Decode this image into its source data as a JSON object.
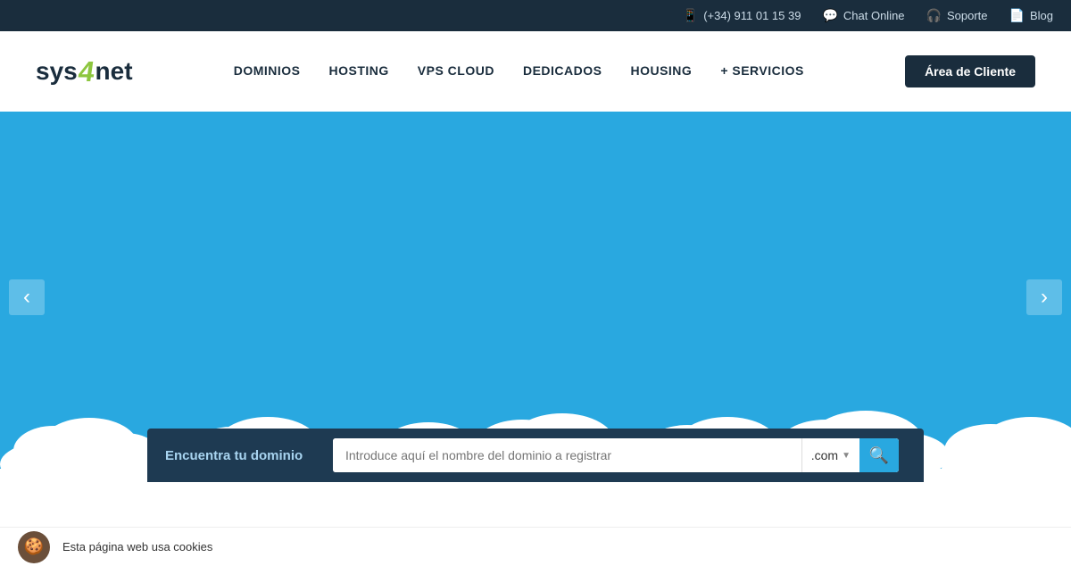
{
  "topbar": {
    "phone": "(+34) 911 01 15 39",
    "chat_label": "Chat Online",
    "soporte_label": "Soporte",
    "blog_label": "Blog"
  },
  "nav": {
    "logo_sys": "sys",
    "logo_4": "4",
    "logo_net": "net",
    "links": [
      {
        "label": "DOMINIOS",
        "id": "nav-dominios"
      },
      {
        "label": "HOSTING",
        "id": "nav-hosting"
      },
      {
        "label": "VPS CLOUD",
        "id": "nav-vps"
      },
      {
        "label": "DEDICADOS",
        "id": "nav-dedicados"
      },
      {
        "label": "HOUSING",
        "id": "nav-housing"
      },
      {
        "label": "+ SERVICIOS",
        "id": "nav-servicios"
      }
    ],
    "cta_label": "Área de Cliente"
  },
  "hero": {
    "arrow_left": "‹",
    "arrow_right": "›",
    "bg_color": "#29a8e0"
  },
  "domain_bar": {
    "label": "Encuentra tu dominio",
    "input_placeholder": "Introduce aquí el nombre del dominio a registrar",
    "tld": ".com",
    "search_icon": "🔍"
  },
  "cookie": {
    "text": "Esta página web usa cookies"
  }
}
